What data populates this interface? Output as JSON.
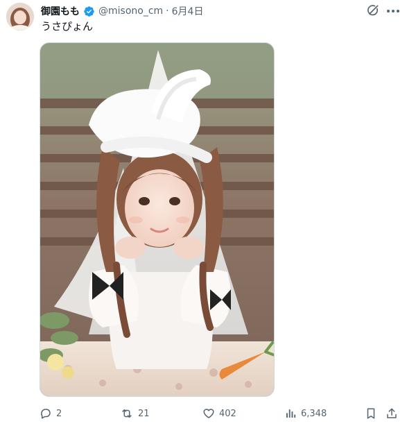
{
  "post": {
    "display_name": "御園もも",
    "handle": "@misono_cm",
    "separator": "·",
    "date": "6月4日",
    "text": "うさぴょん",
    "verified": true
  },
  "actions": {
    "replies": "2",
    "reposts": "21",
    "likes": "402",
    "views": "6,348"
  },
  "colors": {
    "verified_blue": "#1d9bf0",
    "repost_green": "#00ba7c",
    "text_primary": "#0f1419",
    "text_secondary": "#536471"
  },
  "icons": {
    "grok": "grok-icon",
    "more": "more-icon",
    "reply": "reply-icon",
    "repost": "repost-icon",
    "like": "heart-icon",
    "views": "views-icon",
    "bookmark": "bookmark-icon",
    "share": "share-icon"
  }
}
